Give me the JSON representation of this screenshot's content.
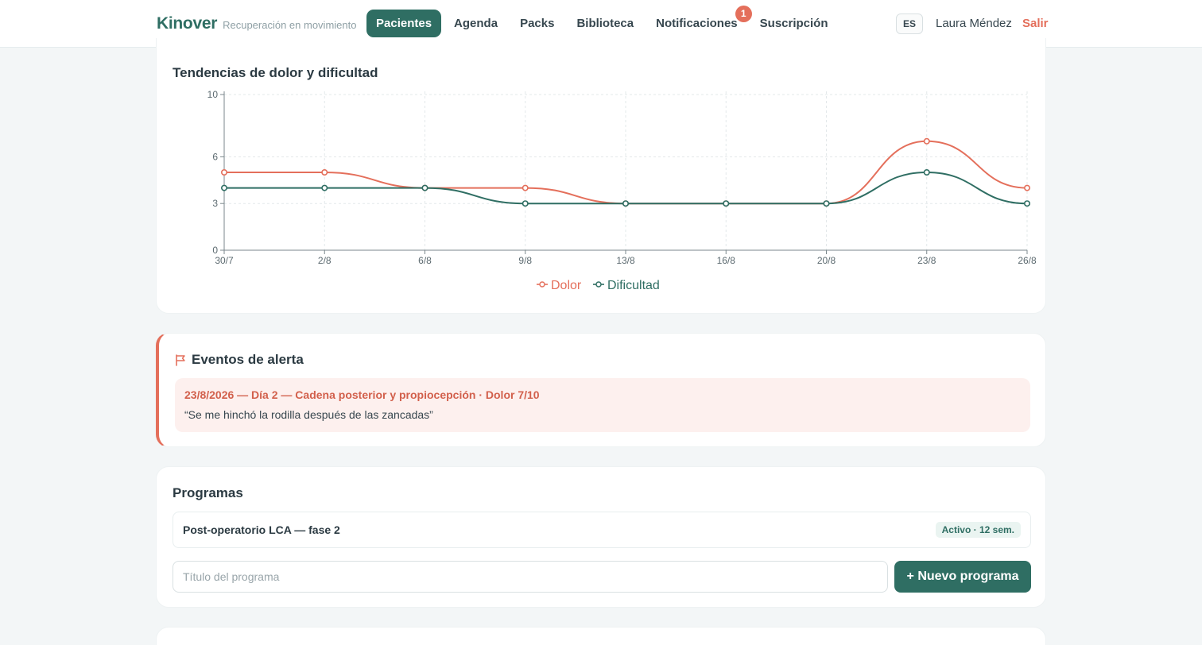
{
  "brand": {
    "name": "Kinover",
    "tagline": "Recuperación en movimiento"
  },
  "nav": {
    "items": [
      {
        "label": "Pacientes",
        "active": true
      },
      {
        "label": "Agenda"
      },
      {
        "label": "Packs"
      },
      {
        "label": "Biblioteca"
      },
      {
        "label": "Notificaciones",
        "badge": "1"
      },
      {
        "label": "Suscripción"
      }
    ],
    "language": "ES",
    "user": "Laura Méndez",
    "logout": "Salir"
  },
  "trends": {
    "title": "Tendencias de dolor y dificultad"
  },
  "chart_data": {
    "type": "line",
    "x": [
      "30/7",
      "2/8",
      "6/8",
      "9/8",
      "13/8",
      "16/8",
      "20/8",
      "23/8",
      "26/8"
    ],
    "series": [
      {
        "name": "Dolor",
        "color": "#e46f5b",
        "values": [
          5,
          5,
          4,
          4,
          3,
          3,
          3,
          7,
          4
        ]
      },
      {
        "name": "Dificultad",
        "color": "#2f6e63",
        "values": [
          4,
          4,
          4,
          3,
          3,
          3,
          3,
          5,
          3
        ]
      }
    ],
    "yticks": [
      0,
      3,
      6,
      10
    ],
    "ylim": [
      0,
      10
    ],
    "grid": true,
    "legend": "bottom-center"
  },
  "alerts": {
    "title": "Eventos de alerta",
    "icon": "flag-icon",
    "entries": [
      {
        "title": "23/8/2026 — Día 2 — Cadena posterior y propiocepción · Dolor 7/10",
        "quote": "“Se me hinchó la rodilla después de las zancadas”"
      }
    ]
  },
  "programs": {
    "title": "Programas",
    "items": [
      {
        "name": "Post-operatorio LCA — fase 2",
        "status": "Activo · 12 sem."
      }
    ],
    "input_placeholder": "Título del programa",
    "input_value": "",
    "new_button": "+ Nuevo programa"
  },
  "colors": {
    "accent": "#2f6e63",
    "alert": "#e46f5b",
    "background": "#f3f6f7"
  }
}
